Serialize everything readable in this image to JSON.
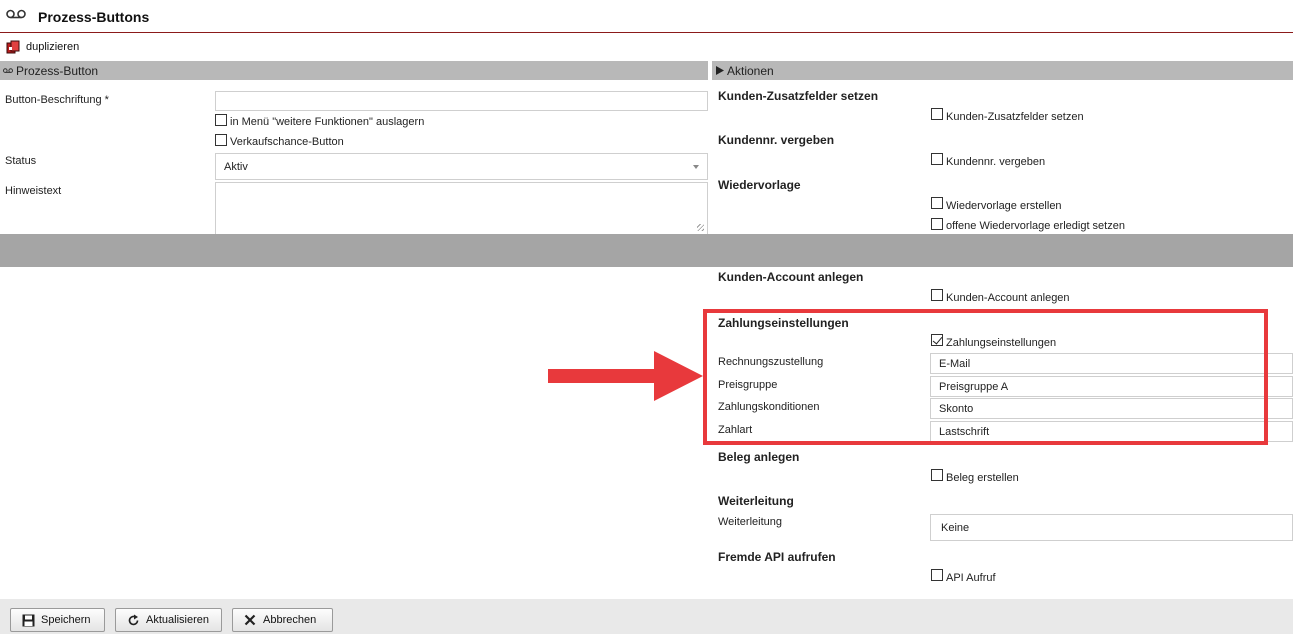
{
  "header": {
    "title": "Prozess-Buttons",
    "icon": "voicemail-icon"
  },
  "toolbar": {
    "duplicate_label": "duplizieren"
  },
  "left_section": {
    "title": "Prozess-Button",
    "fields": {
      "button_label": {
        "label": "Button-Beschriftung *",
        "value": ""
      },
      "more_functions": {
        "label": "in Menü \"weitere Funktionen\" auslagern",
        "checked": false
      },
      "sales_opportunity": {
        "label": "Verkaufschance-Button",
        "checked": false
      },
      "status": {
        "label": "Status",
        "value": "Aktiv"
      },
      "hint_text": {
        "label": "Hinweistext",
        "value": ""
      }
    }
  },
  "right_section": {
    "title": "Aktionen",
    "groups": {
      "customer_fields": {
        "title": "Kunden-Zusatzfelder setzen",
        "checkbox": "Kunden-Zusatzfelder setzen",
        "checked": false
      },
      "customer_number": {
        "title": "Kundennr. vergeben",
        "checkbox": "Kundennr. vergeben",
        "checked": false
      },
      "followup": {
        "title": "Wiedervorlage",
        "checkbox1": "Wiedervorlage erstellen",
        "checkbox2": "offene Wiedervorlage erledigt setzen",
        "checked1": false,
        "checked2": false
      },
      "customer_account": {
        "title": "Kunden-Account anlegen",
        "checkbox": "Kunden-Account anlegen",
        "checked": false
      },
      "payment": {
        "title": "Zahlungseinstellungen",
        "checkbox": "Zahlungseinstellungen",
        "checked": true,
        "invoice_delivery": {
          "label": "Rechnungszustellung",
          "value": "E-Mail"
        },
        "price_group": {
          "label": "Preisgruppe",
          "value": "Preisgruppe A"
        },
        "payment_terms": {
          "label": "Zahlungskonditionen",
          "value": "Skonto"
        },
        "payment_method": {
          "label": "Zahlart",
          "value": "Lastschrift"
        }
      },
      "document": {
        "title": "Beleg anlegen",
        "checkbox": "Beleg erstellen",
        "checked": false
      },
      "forwarding": {
        "title": "Weiterleitung",
        "label": "Weiterleitung",
        "value": "Keine"
      },
      "api": {
        "title": "Fremde API aufrufen",
        "checkbox": "API Aufruf",
        "checked": false
      }
    }
  },
  "footer": {
    "save_label": "Speichern",
    "refresh_label": "Aktualisieren",
    "cancel_label": "Abbrechen"
  },
  "colors": {
    "accent_red": "#e8393c",
    "header_line": "#8b1a1a",
    "section_grey": "#b8b8b8"
  }
}
